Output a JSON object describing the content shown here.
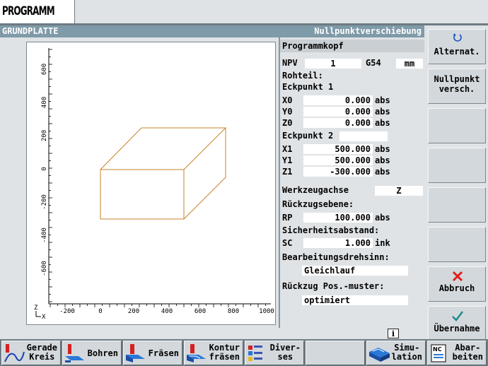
{
  "window": {
    "title": "PROGRAMM"
  },
  "header": {
    "left": "GRUNDPLATTE",
    "right": "Nullpunktverschiebung"
  },
  "form": {
    "title": "Programmkopf",
    "npv_label": "NPV",
    "npv_value": "1",
    "npv_code": "G54",
    "unit": "mm",
    "rohteil_label": "Rohteil:",
    "eck1_label": "Eckpunkt 1",
    "x0_label": "X0",
    "x0_value": "0.000",
    "x0_mode": "abs",
    "y0_label": "Y0",
    "y0_value": "0.000",
    "y0_mode": "abs",
    "z0_label": "Z0",
    "z0_value": "0.000",
    "z0_mode": "abs",
    "eck2_label": "Eckpunkt 2",
    "x1_label": "X1",
    "x1_value": "500.000",
    "x1_mode": "abs",
    "y1_label": "Y1",
    "y1_value": "500.000",
    "y1_mode": "abs",
    "z1_label": "Z1",
    "z1_value": "-300.000",
    "z1_mode": "abs",
    "werkzeug_label": "Werkzeugachse",
    "werkzeug_value": "Z",
    "rueckzug_label": "Rückzugsebene:",
    "rp_label": "RP",
    "rp_value": "100.000",
    "rp_mode": "abs",
    "sicher_label": "Sicherheitsabstand:",
    "sc_label": "SC",
    "sc_value": "1.000",
    "sc_mode": "ink",
    "drehsinn_label": "Bearbeitungsdrehsinn:",
    "drehsinn_value": "Gleichlauf",
    "rueckpos_label": "Rückzug Pos.-muster:",
    "rueckpos_value": "optimiert"
  },
  "softkeys_right": {
    "alternat": "Alternat.",
    "nullpunkt_1": "Nullpunkt",
    "nullpunkt_2": "versch.",
    "abbruch": "Abbruch",
    "uebernahme": "Übernahme"
  },
  "softkeys_bottom": {
    "gerade_1": "Gerade",
    "gerade_2": "Kreis",
    "bohren": "Bohren",
    "fraesen": "Fräsen",
    "kontur_1": "Kontur",
    "kontur_2": "fräsen",
    "divers_1": "Diver-",
    "divers_2": "ses",
    "simu_1": "Simu-",
    "simu_2": "lation",
    "abar_1": "Abar-",
    "abar_2": "beiten",
    "nc_badge": "NC"
  },
  "info_icon": "i",
  "graphic": {
    "x_ticks": [
      "-200",
      "0",
      "200",
      "400",
      "600",
      "800",
      "1000"
    ],
    "y_ticks": [
      "600",
      "400",
      "200",
      "0",
      "-200",
      "-400",
      "-600"
    ],
    "axis_z": "Z",
    "axis_x": "X",
    "box_color": "#c9802b"
  }
}
